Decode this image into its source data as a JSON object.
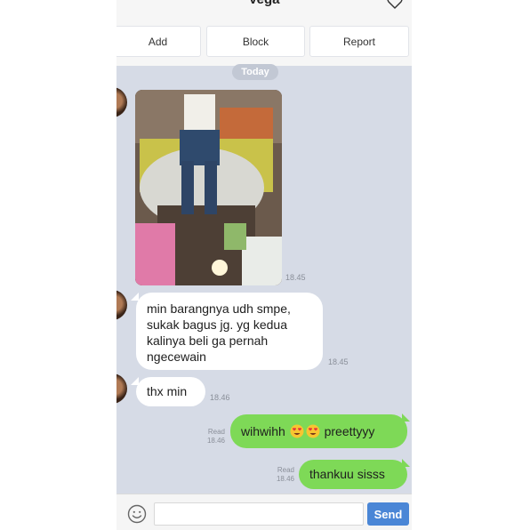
{
  "header": {
    "contact_name": "Vega",
    "favorite_icon": "heart-outline-icon"
  },
  "actions": {
    "add_label": "Add",
    "block_label": "Block",
    "report_label": "Report"
  },
  "date_separator": "Today",
  "messages": [
    {
      "direction": "in",
      "type": "photo",
      "time": "18.45"
    },
    {
      "direction": "in",
      "type": "text",
      "lines": [
        "min barangnya udh smpe,",
        "sukak bagus jg. yg kedua",
        "kalinya beli ga pernah",
        "ngecewain"
      ],
      "time": "18.45"
    },
    {
      "direction": "in",
      "type": "text",
      "text": "thx min",
      "time": "18.46"
    },
    {
      "direction": "out",
      "type": "text",
      "text_before": "wihwihh",
      "emoji": "heart-eyes-emoji",
      "text_after": "preettyyy",
      "read": "Read",
      "time": "18.46"
    },
    {
      "direction": "out",
      "type": "text",
      "text": "thankuu sisss",
      "read": "Read",
      "time": "18.46"
    }
  ],
  "composer": {
    "emoji_icon": "smiley-icon",
    "input_value": "",
    "send_label": "Send"
  },
  "colors": {
    "chat_background": "#d6dbe6",
    "incoming_bubble": "#ffffff",
    "outgoing_bubble": "#7ed957",
    "send_button": "#4a86d6"
  }
}
